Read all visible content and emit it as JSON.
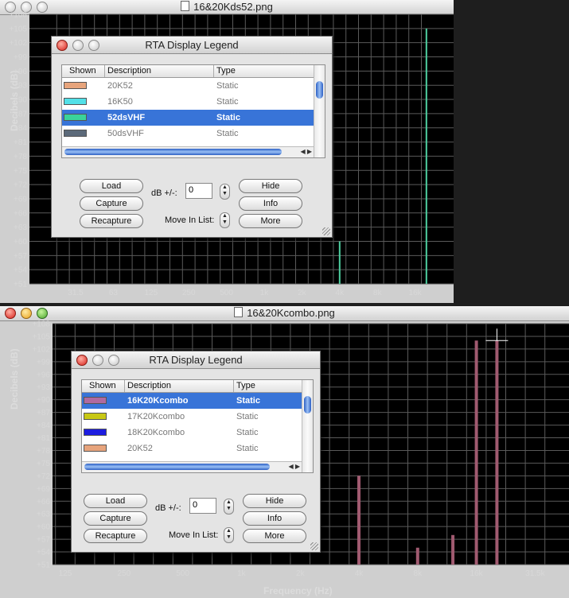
{
  "windows": {
    "top": {
      "title": "16&20Kds52.png",
      "ylabel": "Decibels (dB)",
      "y_ticks": [
        "+108",
        "+105",
        "+102",
        "+99",
        "+96",
        "+93",
        "+90",
        "+87",
        "+84",
        "+81",
        "+78",
        "+75",
        "+72",
        "+69",
        "+66",
        "+63",
        "+60",
        "+57",
        "+54",
        "+51"
      ],
      "x_ticks": [
        "31.5",
        "63",
        "125",
        "250",
        "500",
        "1k",
        "2k",
        "4k",
        "8k",
        "16k"
      ]
    },
    "bottom": {
      "title": "16&20Kcombo.png",
      "ylabel": "Decibels (dB)",
      "xlabel": "Frequency (Hz)",
      "y_ticks": [
        "+108",
        "+105",
        "+102",
        "+99",
        "+96",
        "+93",
        "+90",
        "+87",
        "+84",
        "+81",
        "+78",
        "+75",
        "+72",
        "+69",
        "+66",
        "+63",
        "+60",
        "+57",
        "+54",
        "+51"
      ],
      "x_ticks": [
        "125",
        "250",
        "500",
        "1k",
        "2k",
        "4k",
        "8k",
        "16k",
        "31.5k"
      ]
    }
  },
  "legend_top": {
    "title": "RTA Display Legend",
    "columns": [
      "Shown",
      "Description",
      "Type"
    ],
    "rows": [
      {
        "desc": "20K52",
        "type": "Static",
        "color": "#e7a47c",
        "selected": false
      },
      {
        "desc": "16K50",
        "type": "Static",
        "color": "#52e0e8",
        "selected": false
      },
      {
        "desc": "52dsVHF",
        "type": "Static",
        "color": "#3ad39b",
        "selected": true
      },
      {
        "desc": "50dsVHF",
        "type": "Static",
        "color": "#5c6a7a",
        "selected": false
      }
    ],
    "buttons": {
      "load": "Load",
      "capture": "Capture",
      "recapture": "Recapture",
      "hide": "Hide",
      "info": "Info",
      "more": "More"
    },
    "db_label": "dB +/-:",
    "db_value": "0",
    "move_label": "Move In List:"
  },
  "legend_bottom": {
    "title": "RTA Display Legend",
    "columns": [
      "Shown",
      "Description",
      "Type"
    ],
    "rows": [
      {
        "desc": "16K20Kcombo",
        "type": "Static",
        "color": "#b06aa0",
        "selected": true
      },
      {
        "desc": "17K20Kcombo",
        "type": "Static",
        "color": "#c8c814",
        "selected": false
      },
      {
        "desc": "18K20Kcombo",
        "type": "Static",
        "color": "#1d1de0",
        "selected": false
      },
      {
        "desc": "20K52",
        "type": "Static",
        "color": "#e7a47c",
        "selected": false
      }
    ],
    "buttons": {
      "load": "Load",
      "capture": "Capture",
      "recapture": "Recapture",
      "hide": "Hide",
      "info": "Info",
      "more": "More"
    },
    "db_label": "dB +/-:",
    "db_value": "0",
    "move_label": "Move In List:"
  },
  "chart_data": [
    {
      "type": "bar",
      "title": "16&20Kds52.png",
      "ylabel": "Decibels (dB)",
      "ylim": [
        51,
        108
      ],
      "categories": [
        "4k",
        "16k",
        "20k"
      ],
      "series": [
        {
          "values": [
            60,
            51,
            105
          ],
          "color": "#4ecfa0"
        }
      ]
    },
    {
      "type": "bar",
      "title": "16&20Kcombo.png",
      "ylabel": "Decibels (dB)",
      "xlabel": "Frequency (Hz)",
      "ylim": [
        51,
        108
      ],
      "categories": [
        "4k",
        "8k",
        "12k",
        "16k",
        "20k"
      ],
      "series": [
        {
          "values": [
            72,
            55,
            58,
            104,
            104
          ],
          "color": "#a05a70"
        }
      ]
    }
  ]
}
